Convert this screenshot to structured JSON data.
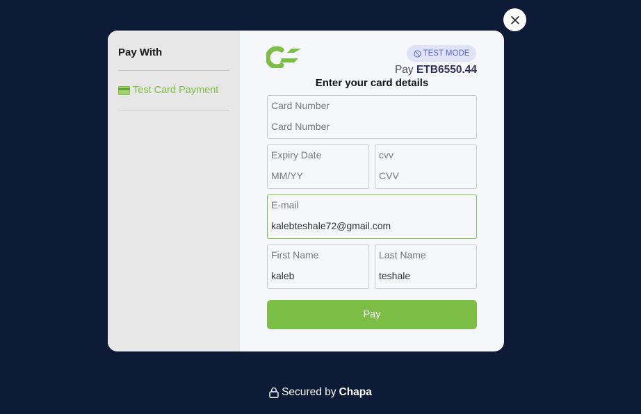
{
  "sidebar": {
    "title": "Pay With",
    "methods": [
      {
        "label": "Test Card Payment",
        "icon": "credit-card-icon"
      }
    ]
  },
  "header": {
    "badge": "TEST MODE",
    "pay_prefix": "Pay",
    "amount": "ETB6550.44"
  },
  "form": {
    "heading": "Enter your card details",
    "card_number": {
      "label": "Card Number",
      "value": "",
      "placeholder": "Card Number"
    },
    "expiry": {
      "label": "Expiry Date",
      "value": "",
      "placeholder": "MM/YY"
    },
    "cvv": {
      "label": "cvv",
      "value": "",
      "placeholder": "CVV"
    },
    "email": {
      "label": "E-mail",
      "value": "kalebteshale72@gmail.com",
      "placeholder": ""
    },
    "first_name": {
      "label": "First Name",
      "value": "kaleb",
      "placeholder": ""
    },
    "last_name": {
      "label": "Last Name",
      "value": "teshale",
      "placeholder": ""
    },
    "pay_button": "Pay"
  },
  "footer": {
    "prefix": "Secured by",
    "brand": "Chapa"
  },
  "colors": {
    "accent": "#7bbd45",
    "background": "#0d1b36",
    "badge": "#5966c4"
  }
}
